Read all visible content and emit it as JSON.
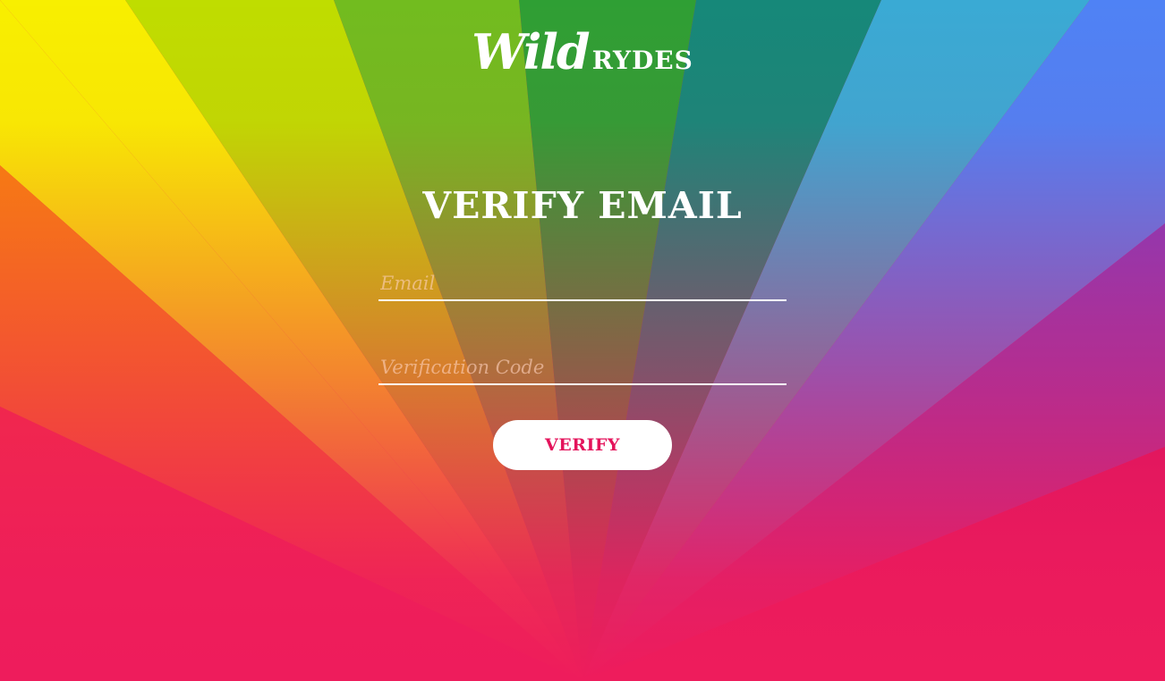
{
  "brand": {
    "script": "Wild",
    "caps": "RYDES"
  },
  "page": {
    "title": "VERIFY EMAIL"
  },
  "form": {
    "email_placeholder": "Email",
    "email_value": "",
    "code_placeholder": "Verification Code",
    "code_value": "",
    "submit_label": "VERIFY"
  },
  "colors": {
    "button_text": "#e4135b",
    "button_bg": "#ffffff",
    "text": "#ffffff",
    "bottom": "#ee1c5c"
  }
}
